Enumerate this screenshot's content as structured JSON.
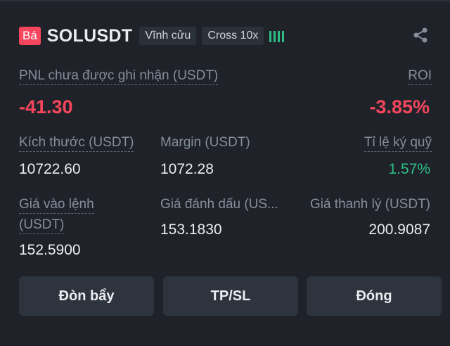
{
  "header": {
    "side": "Bá",
    "symbol": "SOLUSDT",
    "tag_type": "Vĩnh cửu",
    "tag_margin": "Cross 10x"
  },
  "pnl": {
    "label": "PNL chưa được ghi nhận (USDT)",
    "value": "-41.30",
    "roi_label": "ROI",
    "roi_value": "-3.85%"
  },
  "stats": {
    "size_label": "Kích thước (USDT)",
    "size_value": "10722.60",
    "margin_label": "Margin (USDT)",
    "margin_value": "1072.28",
    "ratio_label": "Tỉ lệ ký quỹ",
    "ratio_value": "1.57%",
    "entry_label_1": "Giá vào lệnh",
    "entry_label_2": "(USDT)",
    "entry_value": "152.5900",
    "mark_label": "Giá đánh dấu (US...",
    "mark_value": "153.1830",
    "liq_label": "Giá thanh lý (USDT)",
    "liq_value": "200.9087"
  },
  "buttons": {
    "leverage": "Đòn bẩy",
    "tpsl": "TP/SL",
    "close": "Đóng"
  },
  "colors": {
    "background": "#1f2329",
    "negative": "#f6465d",
    "positive": "#2ebd85",
    "muted": "#848e9c"
  },
  "icons": {
    "share": "share-icon",
    "strength": "signal-strength-icon"
  }
}
